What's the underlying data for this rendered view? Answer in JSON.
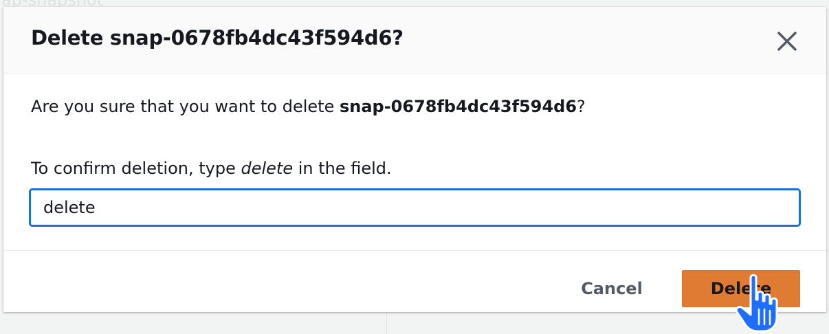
{
  "background": {
    "partial_text": "ap-snapshot"
  },
  "dialog": {
    "title": "Delete snap-0678fb4dc43f594d6?",
    "close_icon": "close-icon",
    "question_prefix": "Are you sure that you want to delete ",
    "question_target": "snap-0678fb4dc43f594d6",
    "question_suffix": "?",
    "instruction_prefix": "To confirm deletion, type ",
    "instruction_keyword": "delete",
    "instruction_suffix": " in the field.",
    "input_value": "delete",
    "cancel_label": "Cancel",
    "delete_label": "Delete"
  },
  "colors": {
    "primary_button": "#e07b33",
    "focus_border": "#1f6ed8",
    "cursor": "#1e6fff"
  },
  "cursor_icon": "pointer-hand-icon"
}
